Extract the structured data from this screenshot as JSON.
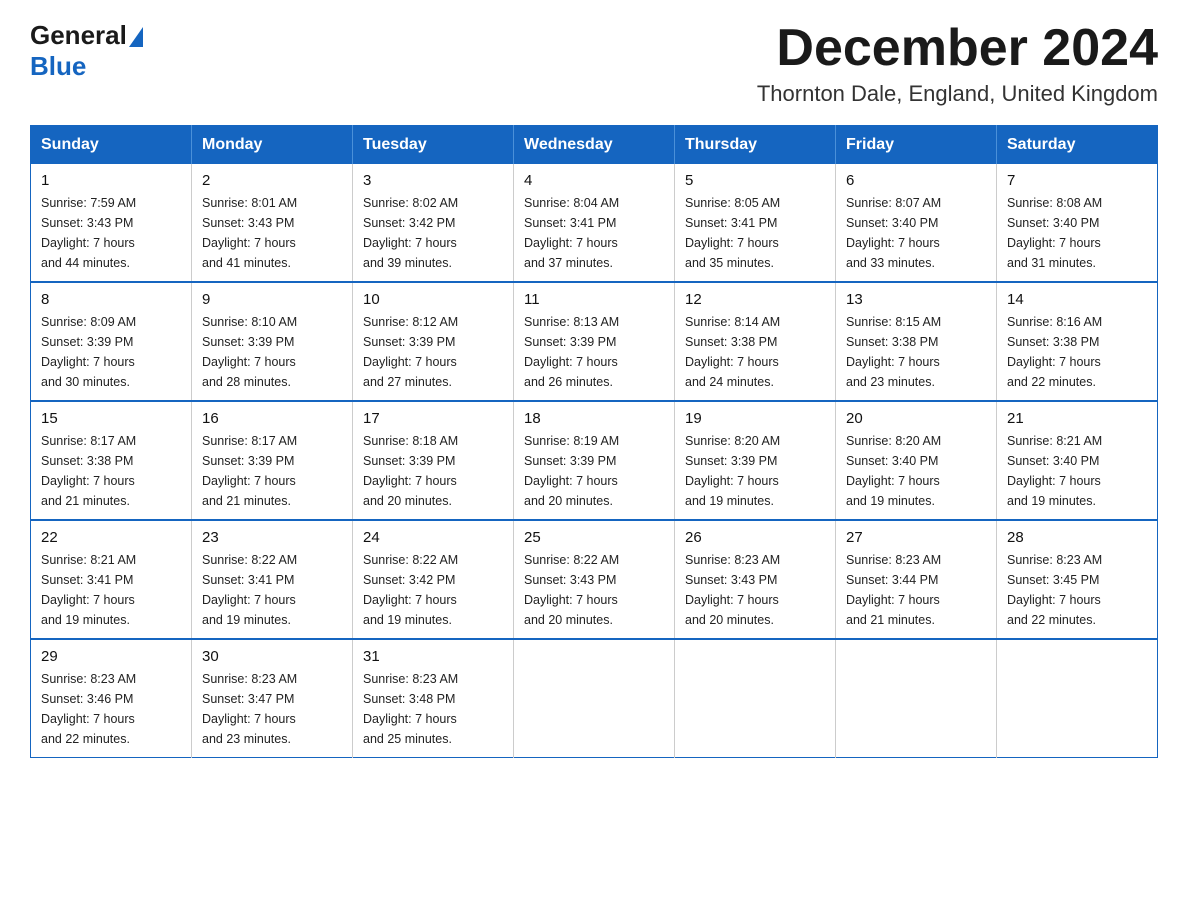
{
  "header": {
    "logo_general": "General",
    "logo_blue": "Blue",
    "month_title": "December 2024",
    "location": "Thornton Dale, England, United Kingdom"
  },
  "days_of_week": [
    "Sunday",
    "Monday",
    "Tuesday",
    "Wednesday",
    "Thursday",
    "Friday",
    "Saturday"
  ],
  "weeks": [
    [
      {
        "day": "1",
        "sunrise": "7:59 AM",
        "sunset": "3:43 PM",
        "daylight": "7 hours and 44 minutes."
      },
      {
        "day": "2",
        "sunrise": "8:01 AM",
        "sunset": "3:43 PM",
        "daylight": "7 hours and 41 minutes."
      },
      {
        "day": "3",
        "sunrise": "8:02 AM",
        "sunset": "3:42 PM",
        "daylight": "7 hours and 39 minutes."
      },
      {
        "day": "4",
        "sunrise": "8:04 AM",
        "sunset": "3:41 PM",
        "daylight": "7 hours and 37 minutes."
      },
      {
        "day": "5",
        "sunrise": "8:05 AM",
        "sunset": "3:41 PM",
        "daylight": "7 hours and 35 minutes."
      },
      {
        "day": "6",
        "sunrise": "8:07 AM",
        "sunset": "3:40 PM",
        "daylight": "7 hours and 33 minutes."
      },
      {
        "day": "7",
        "sunrise": "8:08 AM",
        "sunset": "3:40 PM",
        "daylight": "7 hours and 31 minutes."
      }
    ],
    [
      {
        "day": "8",
        "sunrise": "8:09 AM",
        "sunset": "3:39 PM",
        "daylight": "7 hours and 30 minutes."
      },
      {
        "day": "9",
        "sunrise": "8:10 AM",
        "sunset": "3:39 PM",
        "daylight": "7 hours and 28 minutes."
      },
      {
        "day": "10",
        "sunrise": "8:12 AM",
        "sunset": "3:39 PM",
        "daylight": "7 hours and 27 minutes."
      },
      {
        "day": "11",
        "sunrise": "8:13 AM",
        "sunset": "3:39 PM",
        "daylight": "7 hours and 26 minutes."
      },
      {
        "day": "12",
        "sunrise": "8:14 AM",
        "sunset": "3:38 PM",
        "daylight": "7 hours and 24 minutes."
      },
      {
        "day": "13",
        "sunrise": "8:15 AM",
        "sunset": "3:38 PM",
        "daylight": "7 hours and 23 minutes."
      },
      {
        "day": "14",
        "sunrise": "8:16 AM",
        "sunset": "3:38 PM",
        "daylight": "7 hours and 22 minutes."
      }
    ],
    [
      {
        "day": "15",
        "sunrise": "8:17 AM",
        "sunset": "3:38 PM",
        "daylight": "7 hours and 21 minutes."
      },
      {
        "day": "16",
        "sunrise": "8:17 AM",
        "sunset": "3:39 PM",
        "daylight": "7 hours and 21 minutes."
      },
      {
        "day": "17",
        "sunrise": "8:18 AM",
        "sunset": "3:39 PM",
        "daylight": "7 hours and 20 minutes."
      },
      {
        "day": "18",
        "sunrise": "8:19 AM",
        "sunset": "3:39 PM",
        "daylight": "7 hours and 20 minutes."
      },
      {
        "day": "19",
        "sunrise": "8:20 AM",
        "sunset": "3:39 PM",
        "daylight": "7 hours and 19 minutes."
      },
      {
        "day": "20",
        "sunrise": "8:20 AM",
        "sunset": "3:40 PM",
        "daylight": "7 hours and 19 minutes."
      },
      {
        "day": "21",
        "sunrise": "8:21 AM",
        "sunset": "3:40 PM",
        "daylight": "7 hours and 19 minutes."
      }
    ],
    [
      {
        "day": "22",
        "sunrise": "8:21 AM",
        "sunset": "3:41 PM",
        "daylight": "7 hours and 19 minutes."
      },
      {
        "day": "23",
        "sunrise": "8:22 AM",
        "sunset": "3:41 PM",
        "daylight": "7 hours and 19 minutes."
      },
      {
        "day": "24",
        "sunrise": "8:22 AM",
        "sunset": "3:42 PM",
        "daylight": "7 hours and 19 minutes."
      },
      {
        "day": "25",
        "sunrise": "8:22 AM",
        "sunset": "3:43 PM",
        "daylight": "7 hours and 20 minutes."
      },
      {
        "day": "26",
        "sunrise": "8:23 AM",
        "sunset": "3:43 PM",
        "daylight": "7 hours and 20 minutes."
      },
      {
        "day": "27",
        "sunrise": "8:23 AM",
        "sunset": "3:44 PM",
        "daylight": "7 hours and 21 minutes."
      },
      {
        "day": "28",
        "sunrise": "8:23 AM",
        "sunset": "3:45 PM",
        "daylight": "7 hours and 22 minutes."
      }
    ],
    [
      {
        "day": "29",
        "sunrise": "8:23 AM",
        "sunset": "3:46 PM",
        "daylight": "7 hours and 22 minutes."
      },
      {
        "day": "30",
        "sunrise": "8:23 AM",
        "sunset": "3:47 PM",
        "daylight": "7 hours and 23 minutes."
      },
      {
        "day": "31",
        "sunrise": "8:23 AM",
        "sunset": "3:48 PM",
        "daylight": "7 hours and 25 minutes."
      },
      null,
      null,
      null,
      null
    ]
  ],
  "labels": {
    "sunrise_prefix": "Sunrise: ",
    "sunset_prefix": "Sunset: ",
    "daylight_prefix": "Daylight: "
  }
}
